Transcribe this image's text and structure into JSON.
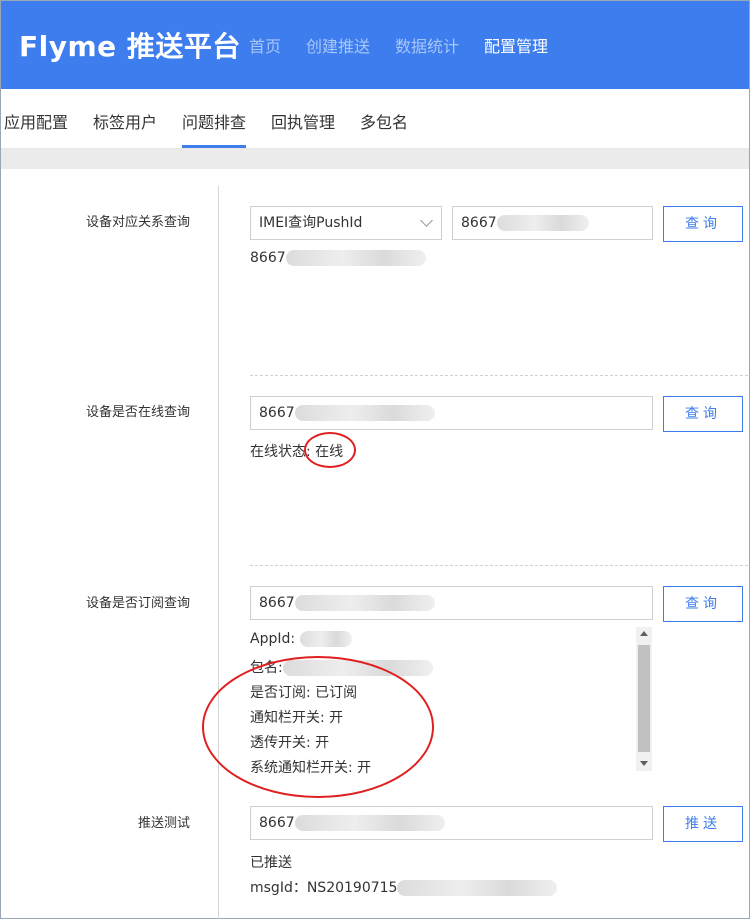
{
  "header": {
    "brand": "Flyme 推送平台",
    "nav": [
      {
        "label": "首页"
      },
      {
        "label": "创建推送"
      },
      {
        "label": "数据统计"
      },
      {
        "label": "配置管理"
      }
    ]
  },
  "subnav": {
    "tabs": [
      {
        "label": "应用配置"
      },
      {
        "label": "标签用户"
      },
      {
        "label": "问题排查"
      },
      {
        "label": "回执管理"
      },
      {
        "label": "多包名"
      }
    ]
  },
  "sections": {
    "mapping": {
      "label": "设备对应关系查询",
      "select_value": "IMEI查询PushId",
      "input_value": "8667",
      "button": "查询",
      "result": "8667"
    },
    "online": {
      "label": "设备是否在线查询",
      "input_value": "8667",
      "button": "查询",
      "status_label": "在线状态:",
      "status_value": "在线"
    },
    "subscribe": {
      "label": "设备是否订阅查询",
      "input_value": "8667",
      "button": "查询",
      "appid_label": "AppId:",
      "package_label": "包名:",
      "subscribed": "是否订阅: 已订阅",
      "notify_switch": "通知栏开关: 开",
      "passthrough_switch": "透传开关: 开",
      "system_notify_switch": "系统通知栏开关: 开"
    },
    "push_test": {
      "label": "推送测试",
      "input_value": "8667",
      "button": "推送",
      "status": "已推送",
      "msgid": "msgId：NS20190715"
    }
  },
  "colors": {
    "primary": "#3d7dee",
    "annotation": "#e02020"
  }
}
